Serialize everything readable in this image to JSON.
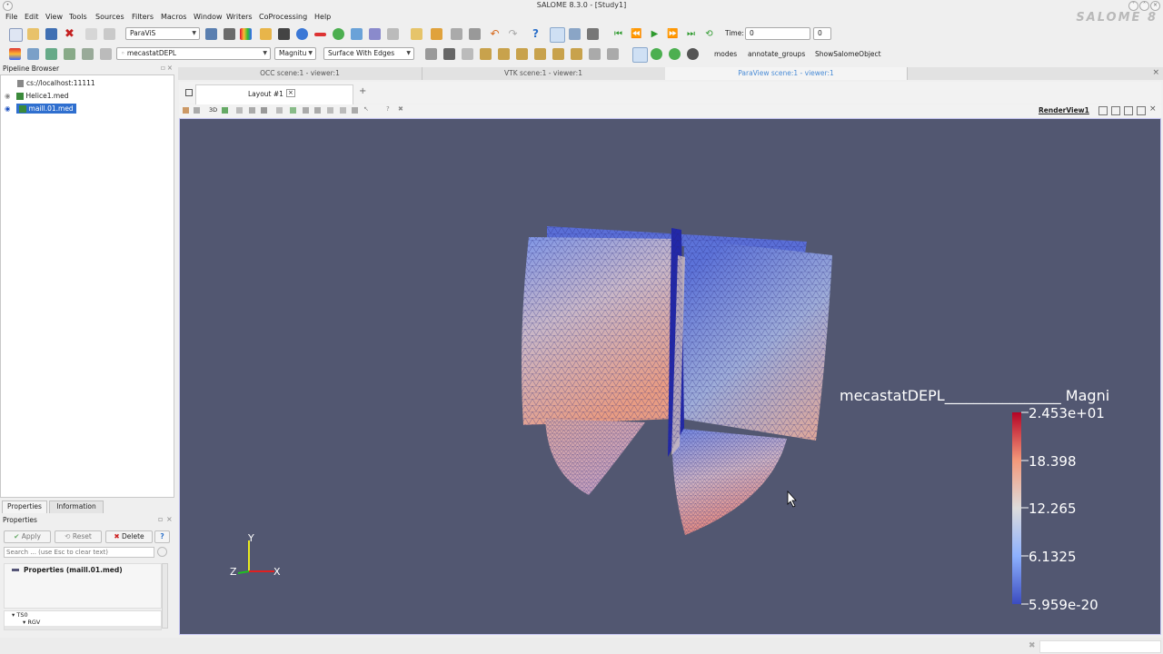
{
  "window": {
    "title": "SALOME 8.3.0 - [Study1]",
    "brand": "SALOME 8"
  },
  "menu": [
    "File",
    "Edit",
    "View",
    "Tools",
    "Sources",
    "Filters",
    "Macros",
    "Window",
    "Writers",
    "CoProcessing",
    "Help"
  ],
  "toolbar1": {
    "module_select": "ParaViS",
    "time_label": "Time:",
    "time_value": "0",
    "time_step": "0"
  },
  "toolbar2": {
    "array_select": "mecastatDEPL",
    "component_select": "Magnitu",
    "representation_select": "Surface With Edges",
    "macros": [
      "modes",
      "annotate_groups",
      "ShowSalomeObject"
    ]
  },
  "pipeline_browser": {
    "title": "Pipeline Browser",
    "server": "cs://localhost:11111",
    "items": [
      "Helice1.med",
      "maill.01.med"
    ]
  },
  "properties_panel": {
    "tabs": [
      "Properties",
      "Information"
    ],
    "title": "Properties",
    "buttons": {
      "apply": "Apply",
      "reset": "Reset",
      "delete": "Delete",
      "help": "?"
    },
    "search_placeholder": "Search ... (use Esc to clear text)",
    "section_title": "Properties (maill.01.med)",
    "tree": [
      "TS0",
      "RGV"
    ]
  },
  "view_tabs": [
    "OCC scene:1 - viewer:1",
    "VTK scene:1 - viewer:1",
    "ParaView scene:1 - viewer:1"
  ],
  "layout": {
    "tab_label": "Layout #1",
    "view_name": "RenderView1",
    "mode_3d": "3D"
  },
  "render_view": {
    "background": "#525771",
    "scalar_bar": {
      "title": "mecastatDEPL________________ Magni",
      "labels": [
        "2.453e+01",
        "18.398",
        "12.265",
        "6.1325",
        "5.959e-20"
      ],
      "colors": [
        "#b40426",
        "#f4987a",
        "#dddcdc",
        "#8db0fe",
        "#3b4cc0"
      ]
    },
    "axes": {
      "x": "X",
      "y": "Y",
      "z": "Z"
    }
  }
}
